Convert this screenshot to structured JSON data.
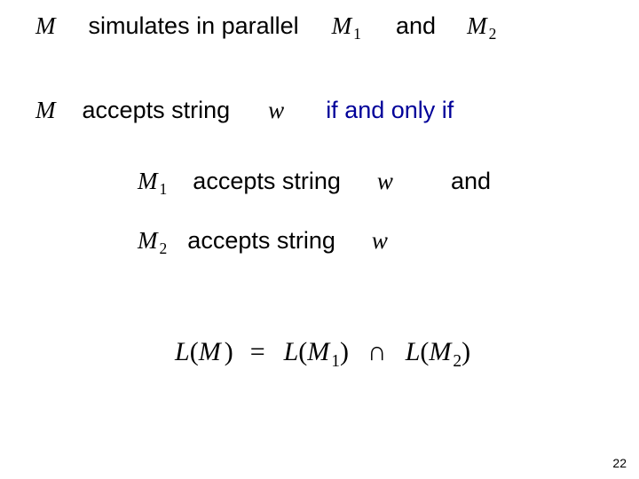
{
  "line1": {
    "M": "M",
    "text1": "simulates in parallel",
    "M1": "M",
    "M1sub": "1",
    "and": "and",
    "M2": "M",
    "M2sub": "2"
  },
  "line2": {
    "M": "M",
    "text1": "accepts string",
    "w": "w",
    "iff": "if and only if"
  },
  "line3": {
    "M1": "M",
    "M1sub": "1",
    "text1": "accepts string",
    "w": "w",
    "and": "and"
  },
  "line4": {
    "M2": "M",
    "M2sub": "2",
    "text1": "accepts string",
    "w": "w"
  },
  "equation": {
    "L1": "L",
    "open1": "(",
    "M": "M",
    "close1": ")",
    "eq": "=",
    "L2": "L",
    "open2": "(",
    "M1": "M",
    "M1sub": "1",
    "close2": ")",
    "cap": "∩",
    "L3": "L",
    "open3": "(",
    "M2": "M",
    "M2sub": "2",
    "close3": ")"
  },
  "page": "22"
}
